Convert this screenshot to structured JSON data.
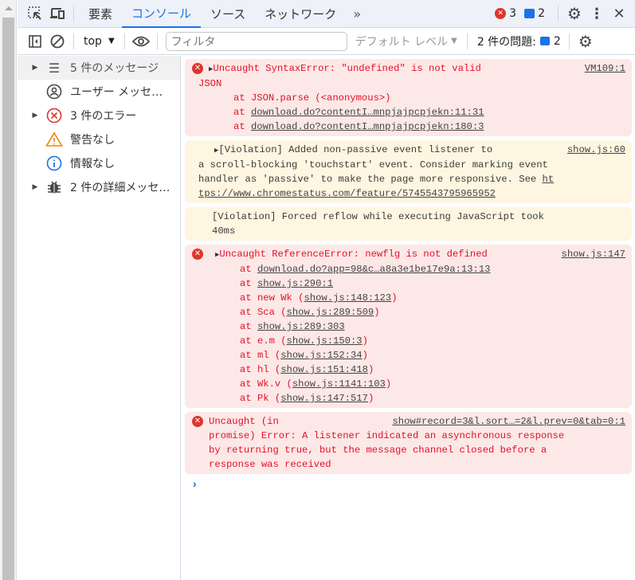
{
  "tabs": [
    "要素",
    "コンソール",
    "ソース",
    "ネットワーク"
  ],
  "active_tab": "コンソール",
  "error_count": "3",
  "message_count": "2",
  "toolbar": {
    "context": "top",
    "filter_placeholder": "フィルタ",
    "level": "デフォルト レベル",
    "issues_label": "2 件の問題:",
    "issues_count": "2"
  },
  "sidebar": [
    "5 件のメッセージ",
    "ユーザー メッセ…",
    "3 件のエラー",
    "警告なし",
    "情報なし",
    "2 件の詳細メッセ…"
  ],
  "messages": {
    "m1": {
      "text": "Uncaught SyntaxError: \"undefined\" is not valid",
      "text2": "JSON",
      "src": "VM109:1",
      "s1": "at JSON.parse (<anonymous>)",
      "s2": "download.do?contentI…mnpjajpcpjekn:11:31",
      "s3": "download.do?contentI…mnpjajpcpjekn:180:3"
    },
    "m2": {
      "l1": "[Violation] Added non-passive event listener to",
      "src": "show.js:60",
      "l2": "a scroll-blocking 'touchstart' event. Consider marking event",
      "l3": "handler as 'passive' to make the page more responsive. See ",
      "l3link": "ht",
      "l4": "tps://www.chromestatus.com/feature/5745543795965952"
    },
    "m3": {
      "l1": "[Violation] Forced reflow while executing JavaScript took",
      "l2": "40ms"
    },
    "m4": {
      "text": "Uncaught ReferenceError: newflg is not defined",
      "src": "show.js:147",
      "stack": [
        [
          "",
          "download.do?app=98&c…a8a3e1be17e9a:13:13",
          ""
        ],
        [
          "",
          "show.js:290:1",
          ""
        ],
        [
          "new Wk (",
          "show.js:148:123",
          ")"
        ],
        [
          "Sca (",
          "show.js:289:509",
          ")"
        ],
        [
          "",
          "show.js:289:303",
          ""
        ],
        [
          "e.m (",
          "show.js:150:3",
          ")"
        ],
        [
          "ml (",
          "show.js:152:34",
          ")"
        ],
        [
          "hl (",
          "show.js:151:418",
          ")"
        ],
        [
          "Wk.v (",
          "show.js:1141:103",
          ")"
        ],
        [
          "Pk (",
          "show.js:147:517",
          ")"
        ]
      ]
    },
    "m5": {
      "l1": "Uncaught (in",
      "src": "show#record=3&l.sort…=2&l.prev=0&tab=0:1",
      "l2": "promise) Error: A listener indicated an asynchronous response",
      "l3": "by returning true, but the message channel closed before a",
      "l4": "response was received"
    }
  }
}
